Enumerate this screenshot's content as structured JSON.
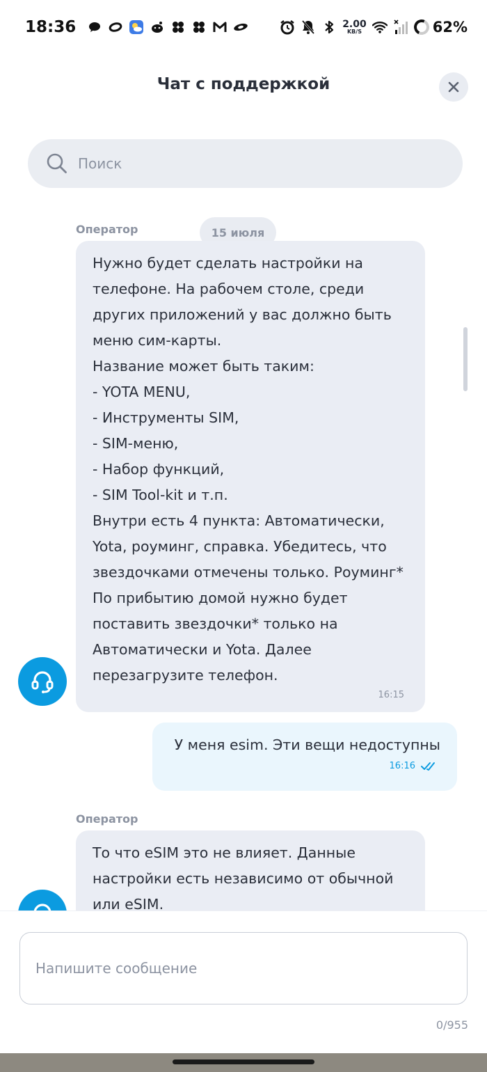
{
  "status_bar": {
    "time": "18:36",
    "net_speed_value": "2.00",
    "net_speed_unit": "KB/S",
    "battery": "62%"
  },
  "header": {
    "title": "Чат с поддержкой"
  },
  "search": {
    "placeholder": "Поиск"
  },
  "chat": {
    "date": "15 июля",
    "messages": [
      {
        "sender": "Оператор",
        "text": "Нужно будет сделать настройки на\nтелефоне. На рабочем столе, среди\nдругих приложений у вас должно быть\nменю сим-карты.\nНазвание может быть таким:\n- YOTA MENU,\n- Инструменты SIM,\n- SIM-меню,\n- Набор функций,\n- SIM Tool-kit и т.п.\nВнутри есть 4 пункта: Автоматически,\nYota, роуминг, справка. Убедитесь, что\nзвездочками отмечены только. Роуминг*\nПо прибытию домой нужно будет\nпоставить звездочки* только на\nАвтоматически и Yota. Далее\nперезагрузите телефон.",
        "time": "16:15"
      },
      {
        "sender": "me",
        "text": "У меня esim. Эти вещи недоступны",
        "time": "16:16"
      },
      {
        "sender": "Оператор",
        "text": "То что eSIM это не влияет. Данные\nнастройки есть независимо от обычной\nили eSIM."
      }
    ]
  },
  "composer": {
    "placeholder": "Напишите сообщение",
    "counter": "0/955"
  },
  "colors": {
    "accent": "#0b9be0",
    "operator_bubble": "#eaedf4",
    "user_bubble": "#eaf6fd"
  }
}
